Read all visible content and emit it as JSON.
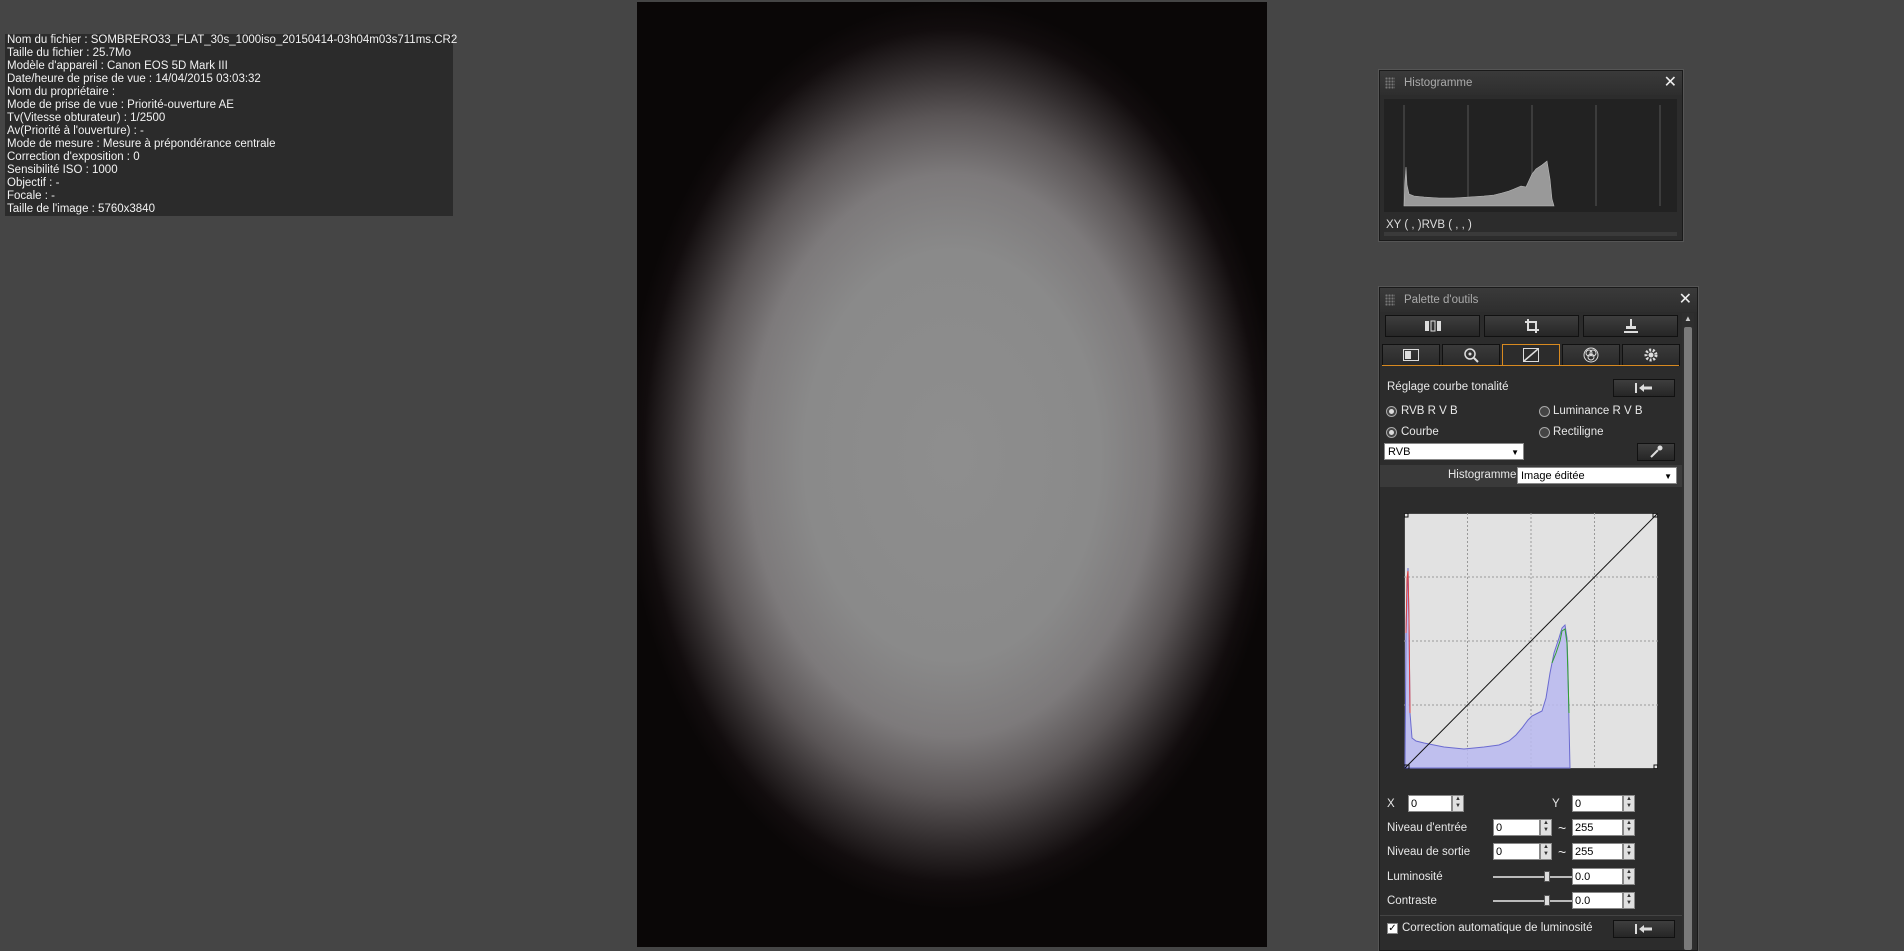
{
  "info": {
    "lines": [
      "Nom du fichier : SOMBRERO33_FLAT_30s_1000iso_20150414-03h04m03s711ms.CR2",
      "Taille du fichier : 25.7Mo",
      "Modèle d'appareil : Canon EOS 5D Mark III",
      "Date/heure de prise de vue : 14/04/2015 03:03:32",
      "Nom du propriétaire :",
      "Mode de prise de vue : Priorité-ouverture AE",
      "Tv(Vitesse obturateur) : 1/2500",
      "Av(Priorité à l'ouverture) : -",
      "Mode de mesure : Mesure à prépondérance centrale",
      "Correction d'exposition : 0",
      "Sensibilité ISO : 1000",
      "Objectif : -",
      "Focale : -",
      "Taille de l'image : 5760x3840"
    ]
  },
  "histogram_panel": {
    "title": "Histogramme",
    "close": "✕",
    "readout": "XY (    ,     )RVB (    ,    ,    )"
  },
  "tool_palette": {
    "title": "Palette d'outils",
    "close": "✕",
    "section_title": "Réglage courbe tonalité",
    "radio_rgb": "RVB R V B",
    "radio_luminance": "Luminance R V B",
    "radio_curve": "Courbe",
    "radio_linear": "Rectiligne",
    "channel_select": "RVB",
    "histogram_label": "Histogramme",
    "histogram_select": "Image éditée",
    "x_label": "X",
    "x_value": "0",
    "y_label": "Y",
    "y_value": "0",
    "input_level_label": "Niveau d'entrée",
    "input_low": "0",
    "input_high": "255",
    "output_level_label": "Niveau de sortie",
    "output_low": "0",
    "output_high": "255",
    "tilde": "~",
    "brightness_label": "Luminosité",
    "brightness_value": "0.0",
    "contrast_label": "Contraste",
    "contrast_value": "0.0",
    "auto_brightness_label": "Correction automatique de luminosité",
    "auto_brightness_checked": true
  }
}
